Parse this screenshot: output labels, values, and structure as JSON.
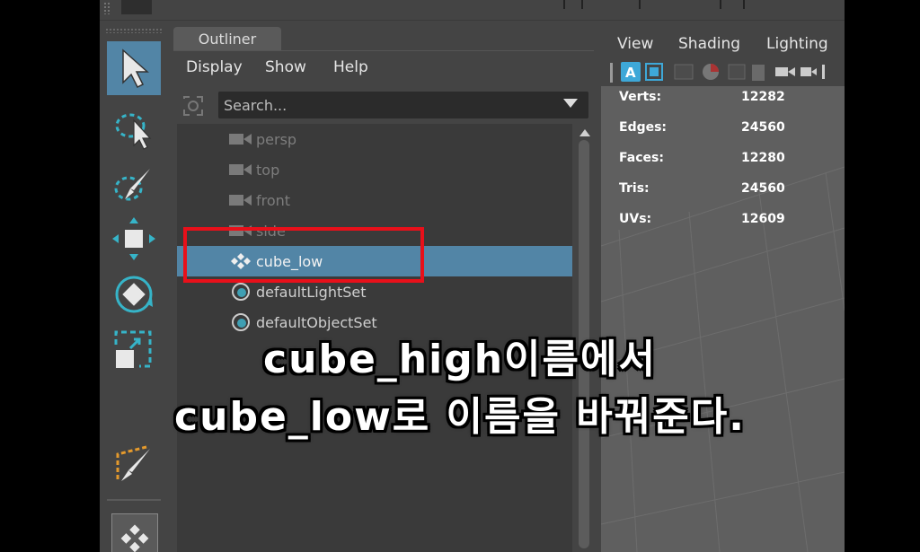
{
  "outliner": {
    "tab_label": "Outliner",
    "menu": [
      "Display",
      "Show",
      "Help"
    ],
    "search_placeholder": "Search...",
    "items": [
      {
        "label": "persp",
        "icon": "camera-icon",
        "state": "dim"
      },
      {
        "label": "top",
        "icon": "camera-icon",
        "state": "dim"
      },
      {
        "label": "front",
        "icon": "camera-icon",
        "state": "dim"
      },
      {
        "label": "side",
        "icon": "camera-icon",
        "state": "dim"
      },
      {
        "label": "cube_low",
        "icon": "transform-mesh-icon",
        "state": "selected"
      },
      {
        "label": "defaultLightSet",
        "icon": "set-icon",
        "state": "normal"
      },
      {
        "label": "defaultObjectSet",
        "icon": "set-icon",
        "state": "normal"
      }
    ]
  },
  "viewport": {
    "menu": [
      "View",
      "Shading",
      "Lighting"
    ],
    "hud": [
      {
        "label": "Verts:",
        "value": "12282"
      },
      {
        "label": "Edges:",
        "value": "24560"
      },
      {
        "label": "Faces:",
        "value": "12280"
      },
      {
        "label": "Tris:",
        "value": "24560"
      },
      {
        "label": "UVs:",
        "value": "12609"
      }
    ]
  },
  "toolbox": {
    "tools": [
      "select-arrow-icon",
      "lasso-select-icon",
      "paint-select-icon",
      "move-icon",
      "rotate-icon",
      "scale-icon",
      "soft-mod-icon",
      "last-tool-icon"
    ]
  },
  "caption": {
    "line1": "cube_high이름에서",
    "line2": "cube_low로 이름을 바꿔준다."
  },
  "colors": {
    "selection": "#5285a6",
    "highlight_box": "#e8101a",
    "panel_bg": "#444444",
    "tree_bg": "#3a3a3a",
    "viewport_bg": "#5f5f5f"
  }
}
